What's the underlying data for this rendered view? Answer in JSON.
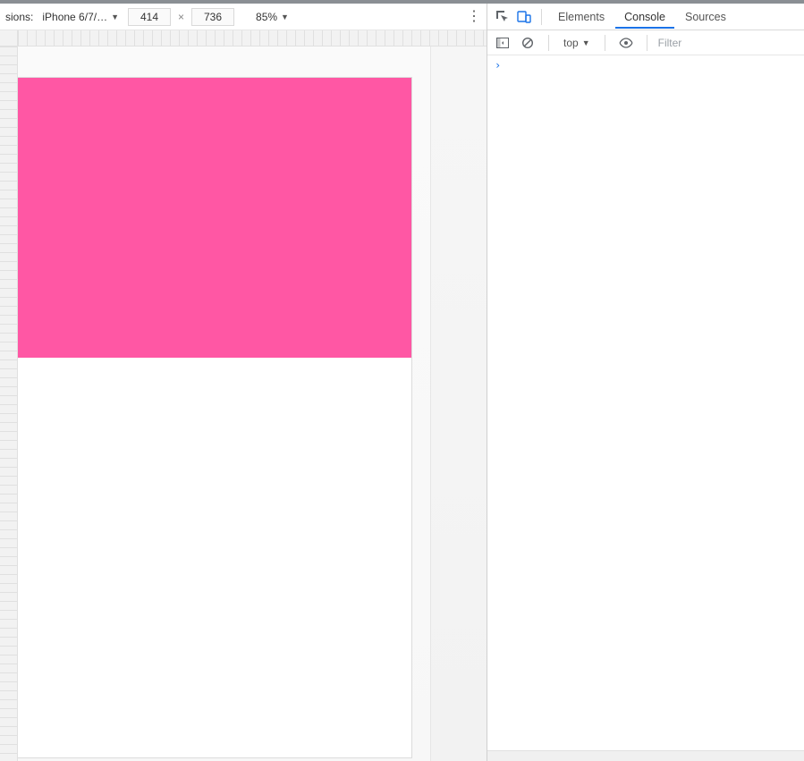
{
  "device_toolbar": {
    "dimensions_label": "sions:",
    "device_name": "iPhone 6/7/…",
    "width": "414",
    "height": "736",
    "zoom": "85%"
  },
  "devtools": {
    "tabs": {
      "elements": "Elements",
      "console": "Console",
      "sources": "Sources"
    },
    "console_toolbar": {
      "context": "top",
      "filter_placeholder": "Filter"
    },
    "prompt": "›"
  },
  "colors": {
    "pink": "#ff57a4",
    "accent": "#1a73e8"
  }
}
